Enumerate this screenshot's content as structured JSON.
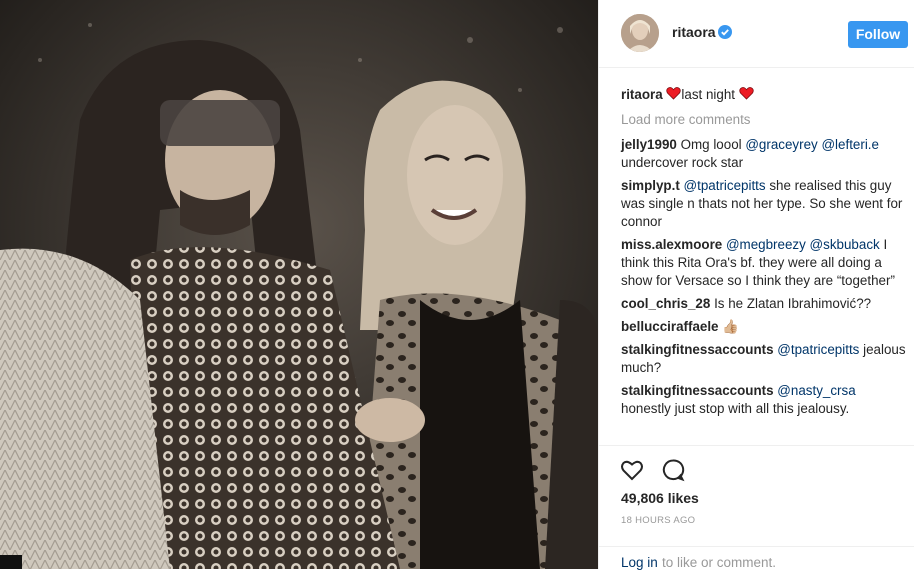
{
  "post": {
    "username": "ritaora",
    "follow_label": "Follow",
    "caption_user": "ritaora",
    "caption_text": "last night",
    "load_more": "Load more comments",
    "likes": "49,806 likes",
    "time": "18 HOURS AGO",
    "login_link": "Log in",
    "login_rest": "to like or comment.",
    "accent_color": "#3897f0",
    "heart_color": "#ed1c24"
  },
  "comments": [
    {
      "user": "jelly1990",
      "parts": [
        {
          "t": "Omg loool "
        },
        {
          "t": "@graceyrey",
          "m": true
        },
        {
          "t": " "
        },
        {
          "t": "@lefteri.e",
          "m": true
        },
        {
          "t": " undercover rock star"
        }
      ]
    },
    {
      "user": "simplyp.t",
      "parts": [
        {
          "t": "@tpatricepitts",
          "m": true
        },
        {
          "t": " she realised this guy was single n thats not her type. So she went for connor"
        }
      ]
    },
    {
      "user": "miss.alexmoore",
      "parts": [
        {
          "t": "@megbreezy",
          "m": true
        },
        {
          "t": " "
        },
        {
          "t": "@skbuback",
          "m": true
        },
        {
          "t": " I think this Rita Ora's bf. they were all doing a show for Versace so I think they are “together”"
        }
      ]
    },
    {
      "user": "cool_chris_28",
      "parts": [
        {
          "t": "Is he Zlatan Ibrahimović??"
        }
      ]
    },
    {
      "user": "belluccirаffaele",
      "parts": [
        {
          "t": "👍🏼"
        }
      ]
    },
    {
      "user": "stalkingfitnessaccounts",
      "parts": [
        {
          "t": "@tpatricepitts",
          "m": true
        },
        {
          "t": " jealous much?"
        }
      ]
    },
    {
      "user": "stalkingfitnessaccounts",
      "parts": [
        {
          "t": "@nasty_crsa",
          "m": true
        },
        {
          "t": " honestly just stop with all this jealousy."
        }
      ]
    }
  ],
  "icons": {
    "like": "heart-outline-icon",
    "comment": "speech-bubble-icon",
    "verified": "verified-badge-icon"
  }
}
